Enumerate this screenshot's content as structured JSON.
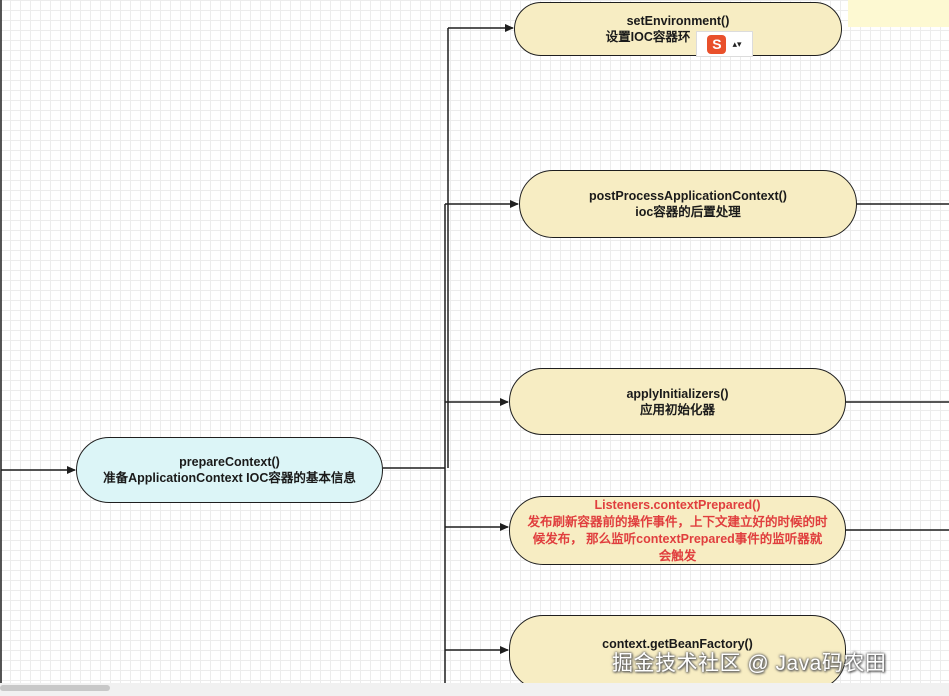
{
  "nodes": {
    "root": {
      "title": "prepareContext()",
      "desc": "准备ApplicationContext IOC容器的基本信息"
    },
    "n1": {
      "title": "setEnvironment()",
      "desc": "设置IOC容器环"
    },
    "n2": {
      "title": "postProcessApplicationContext()",
      "desc": "ioc容器的后置处理"
    },
    "n3": {
      "title": "applyInitializers()",
      "desc": "应用初始化器"
    },
    "n4": {
      "title": "Listeners.contextPrepared()",
      "line1": "发布刷新容器前的操作事件，上下文建立好的时候的时",
      "line2": "候发布， 那么监听contextPrepared事件的监听器就",
      "line3": "会触发"
    },
    "n5": {
      "title": "context.getBeanFactory()"
    }
  },
  "ime_toolbar": {
    "logo": "S",
    "arrows": "▴▾"
  },
  "watermark": "掘金技术社区 @ Java码农田",
  "colors": {
    "node_yellow": "#f7edc3",
    "node_cyan": "#dcf5f7",
    "highlight_red": "#e03e3e",
    "edge": "#1f1f1f"
  }
}
